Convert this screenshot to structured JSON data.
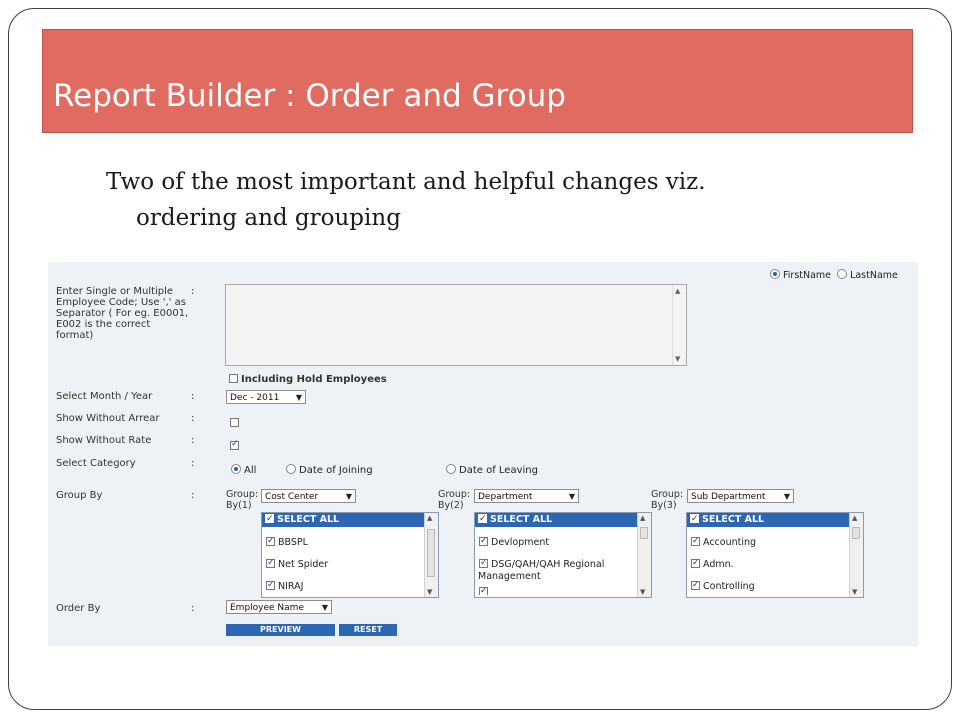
{
  "slide": {
    "title": "Report Builder : Order and Group",
    "subtitle_line1": "Two of the most important and helpful changes viz.",
    "subtitle_line2": "ordering and grouping"
  },
  "form": {
    "name_order": {
      "options": [
        "FirstName",
        "LastName"
      ],
      "selected": "FirstName"
    },
    "employee_code_label_lines": [
      "Enter Single or Multiple",
      "Employee Code; Use ',' as",
      "Separator ( For eg. E0001,",
      "E002 is the correct",
      "format)"
    ],
    "colon": ":",
    "employee_code_value": "",
    "including_hold": {
      "label": "Including Hold Employees",
      "checked": false
    },
    "month_year": {
      "label": "Select Month / Year",
      "value": "Dec - 2011"
    },
    "without_arrear": {
      "label": "Show Without Arrear",
      "checked": false
    },
    "without_rate": {
      "label": "Show Without Rate",
      "checked": true
    },
    "category": {
      "label": "Select Category",
      "options": [
        "All",
        "Date of Joining",
        "Date of Leaving"
      ],
      "selected": "All"
    },
    "group_by": {
      "label": "Group By",
      "groups": [
        {
          "caption_line1": "Group:",
          "caption_line2": "By(1)",
          "value": "Cost Center",
          "select_all": "SELECT ALL",
          "items": [
            "BBSPL",
            "Net Spider",
            "NIRAJ"
          ]
        },
        {
          "caption_line1": "Group:",
          "caption_line2": "By(2)",
          "value": "Department",
          "select_all": "SELECT ALL",
          "items": [
            "Devlopment",
            "DSG/QAH/QAH Regional",
            "Management"
          ]
        },
        {
          "caption_line1": "Group:",
          "caption_line2": "By(3)",
          "value": "Sub Department",
          "select_all": "SELECT ALL",
          "items": [
            "Accounting",
            "Admn.",
            "Controlling"
          ]
        }
      ]
    },
    "order_by": {
      "label": "Order By",
      "value": "Employee Name"
    },
    "buttons": {
      "preview": "PREVIEW",
      "reset": "RESET"
    }
  },
  "colors": {
    "title_bar": "#e06b60",
    "accent_blue": "#2d66b3"
  }
}
